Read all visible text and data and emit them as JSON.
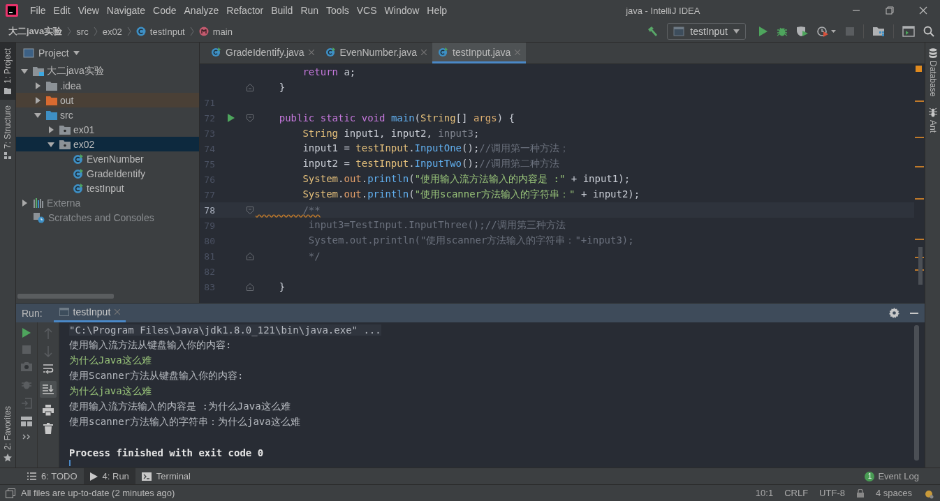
{
  "window": {
    "title": "java - IntelliJ IDEA"
  },
  "menu": [
    "File",
    "Edit",
    "View",
    "Navigate",
    "Code",
    "Analyze",
    "Refactor",
    "Build",
    "Run",
    "Tools",
    "VCS",
    "Window",
    "Help"
  ],
  "breadcrumbs": [
    {
      "label": "大二java实验",
      "kind": "project"
    },
    {
      "label": "src",
      "kind": "folder"
    },
    {
      "label": "ex02",
      "kind": "folder"
    },
    {
      "label": "testInput",
      "kind": "class"
    },
    {
      "label": "main",
      "kind": "method"
    }
  ],
  "toolbar": {
    "run_config": "testInput"
  },
  "left_stripe": [
    {
      "label": "1: Project",
      "selected": true
    },
    {
      "label": "7: Structure",
      "selected": false
    }
  ],
  "left_stripe_bottom": [
    {
      "label": "2: Favorites",
      "selected": false
    }
  ],
  "project_panel": {
    "title": "Project",
    "tree": [
      {
        "label": "大二java实验",
        "kind": "project",
        "expanded": true,
        "selected": false,
        "children": [
          {
            "label": ".idea",
            "kind": "folder",
            "expanded": false,
            "selected": false
          },
          {
            "label": "out",
            "kind": "excluded",
            "expanded": false,
            "selected": false
          },
          {
            "label": "src",
            "kind": "source",
            "expanded": true,
            "selected": false,
            "children": [
              {
                "label": "ex01",
                "kind": "package",
                "expanded": false,
                "selected": false
              },
              {
                "label": "ex02",
                "kind": "package",
                "expanded": true,
                "selected": true,
                "children": [
                  {
                    "label": "EvenNumber",
                    "kind": "class",
                    "selected": false
                  },
                  {
                    "label": "GradeIdentify",
                    "kind": "class",
                    "selected": false
                  },
                  {
                    "label": "testInput",
                    "kind": "class",
                    "selected": false
                  }
                ]
              }
            ]
          }
        ]
      },
      {
        "label": "Externa",
        "kind": "libraries",
        "expanded": false,
        "selected": false
      },
      {
        "label": "Scratches and Consoles",
        "kind": "scratches",
        "selected": false
      }
    ]
  },
  "editor": {
    "tabs": [
      {
        "label": "GradeIdentify.java",
        "selected": false
      },
      {
        "label": "EvenNumber.java",
        "selected": false
      },
      {
        "label": "testInput.java",
        "selected": true
      }
    ],
    "lines": [
      {
        "kind": "plain",
        "run": false,
        "current": false,
        "tokens": [
          {
            "kind": "kw",
            "text": "        return"
          },
          {
            "kind": "plain",
            "text": " a;"
          }
        ]
      },
      {
        "kind": "fold-end",
        "run": false,
        "current": false,
        "tokens": [
          {
            "kind": "plain",
            "text": "    }"
          }
        ]
      },
      {
        "kind": "plain",
        "number": "71",
        "run": false,
        "current": false
      },
      {
        "kind": "fold-start",
        "number": "72",
        "run": true,
        "current": false,
        "tokens": [
          {
            "kind": "kw",
            "text": "    public static void "
          },
          {
            "kind": "fn",
            "text": "main"
          },
          {
            "kind": "plain",
            "text": "("
          },
          {
            "kind": "type",
            "text": "String"
          },
          {
            "kind": "plain",
            "text": "[] "
          },
          {
            "kind": "param",
            "text": "args"
          },
          {
            "kind": "plain",
            "text": ") {"
          }
        ]
      },
      {
        "kind": "plain",
        "number": "73",
        "run": false,
        "current": false,
        "tokens": [
          {
            "kind": "type",
            "text": "        String"
          },
          {
            "kind": "plain",
            "text": " input1, input2, "
          },
          {
            "kind": "unused",
            "text": "input3"
          },
          {
            "kind": "plain",
            "text": ";"
          }
        ]
      },
      {
        "kind": "plain",
        "number": "74",
        "run": false,
        "current": false,
        "tokens": [
          {
            "kind": "plain",
            "text": "        input1 = "
          },
          {
            "kind": "type",
            "text": "testInput"
          },
          {
            "kind": "plain",
            "text": "."
          },
          {
            "kind": "fn",
            "text": "InputOne"
          },
          {
            "kind": "plain",
            "text": "();"
          },
          {
            "kind": "cmt",
            "text": "//调用第一种方法；"
          }
        ]
      },
      {
        "kind": "plain",
        "number": "75",
        "run": false,
        "current": false,
        "tokens": [
          {
            "kind": "plain",
            "text": "        input2 = "
          },
          {
            "kind": "type",
            "text": "testInput"
          },
          {
            "kind": "plain",
            "text": "."
          },
          {
            "kind": "fn",
            "text": "InputTwo"
          },
          {
            "kind": "plain",
            "text": "();"
          },
          {
            "kind": "cmt",
            "text": "//调用第二种方法"
          }
        ]
      },
      {
        "kind": "plain",
        "number": "76",
        "run": false,
        "current": false,
        "tokens": [
          {
            "kind": "type",
            "text": "        System"
          },
          {
            "kind": "plain",
            "text": "."
          },
          {
            "kind": "field",
            "text": "out"
          },
          {
            "kind": "plain",
            "text": "."
          },
          {
            "kind": "fn",
            "text": "println"
          },
          {
            "kind": "plain",
            "text": "("
          },
          {
            "kind": "str",
            "text": "\"使用输入流方法输入的内容是 :\""
          },
          {
            "kind": "plain",
            "text": " + input1);"
          }
        ]
      },
      {
        "kind": "plain",
        "number": "77",
        "run": false,
        "current": false,
        "tokens": [
          {
            "kind": "type",
            "text": "        System"
          },
          {
            "kind": "plain",
            "text": "."
          },
          {
            "kind": "field",
            "text": "out"
          },
          {
            "kind": "plain",
            "text": "."
          },
          {
            "kind": "fn",
            "text": "println"
          },
          {
            "kind": "plain",
            "text": "("
          },
          {
            "kind": "str",
            "text": "\"使用scanner方法输入的字符串：\""
          },
          {
            "kind": "plain",
            "text": " + input2);"
          }
        ]
      },
      {
        "kind": "fold-start",
        "number": "78",
        "run": false,
        "current": true,
        "tokens": [
          {
            "kind": "warn",
            "text": "        /**"
          }
        ]
      },
      {
        "kind": "plain",
        "number": "79",
        "run": false,
        "current": false,
        "tokens": [
          {
            "kind": "cmt",
            "text": "         input3=TestInput.InputThree();//调用第三种方法"
          }
        ]
      },
      {
        "kind": "plain",
        "number": "80",
        "run": false,
        "current": false,
        "tokens": [
          {
            "kind": "cmt",
            "text": "         System.out.println(\"使用scanner方法输入的字符串：\"+input3);"
          }
        ]
      },
      {
        "kind": "fold-end",
        "number": "81",
        "run": false,
        "current": false,
        "tokens": [
          {
            "kind": "cmt",
            "text": "         */"
          }
        ]
      },
      {
        "kind": "plain",
        "number": "82",
        "run": false,
        "current": false
      },
      {
        "kind": "fold-end",
        "number": "83",
        "run": false,
        "current": false,
        "tokens": [
          {
            "kind": "plain",
            "text": "    }"
          }
        ]
      }
    ]
  },
  "right_stripe": [
    "Database",
    "Ant"
  ],
  "run_panel": {
    "label": "Run:",
    "tab": "testInput",
    "console": [
      {
        "kind": "command",
        "text": "\"C:\\Program Files\\Java\\jdk1.8.0_121\\bin\\java.exe\" ..."
      },
      {
        "kind": "output",
        "text": "使用输入流方法从键盘输入你的内容:"
      },
      {
        "kind": "input",
        "text": "为什么Java这么难"
      },
      {
        "kind": "output",
        "text": "使用Scanner方法从键盘输入你的内容:"
      },
      {
        "kind": "input",
        "text": "为什么java这么难"
      },
      {
        "kind": "output",
        "text": "使用输入流方法输入的内容是 :为什么Java这么难"
      },
      {
        "kind": "output",
        "text": "使用scanner方法输入的字符串：为什么java这么难"
      },
      {
        "kind": "blank"
      },
      {
        "kind": "status",
        "text": "Process finished with exit code 0"
      }
    ]
  },
  "bottom_tabs": [
    {
      "label": "6: TODO",
      "kind": "todo",
      "selected": false
    },
    {
      "label": "4: Run",
      "kind": "run",
      "selected": true
    },
    {
      "label": "Terminal",
      "kind": "terminal",
      "selected": false
    }
  ],
  "event_log": {
    "label": "Event Log",
    "count": "1"
  },
  "status_bar": {
    "message": "All files are up-to-date (2 minutes ago)",
    "position": "10:1",
    "line_separator": "CRLF",
    "encoding": "UTF-8",
    "indent": "4 spaces"
  }
}
